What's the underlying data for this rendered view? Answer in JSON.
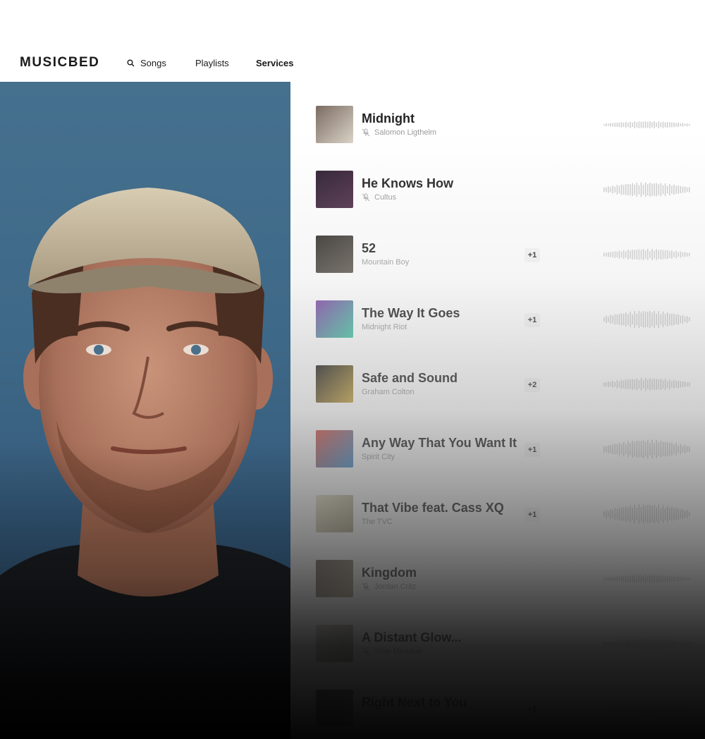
{
  "nav": {
    "logo": "MUSICBED",
    "songs": "Songs",
    "playlists": "Playlists",
    "services": "Services"
  },
  "songs": [
    {
      "title": "Midnight",
      "artist": "Salomon Ligthelm",
      "badge": "",
      "icon": true,
      "colors": [
        "#7a6a60",
        "#d9d2c6"
      ]
    },
    {
      "title": "He Knows How",
      "artist": "Cultus",
      "badge": "",
      "icon": true,
      "colors": [
        "#2a1a2e",
        "#4a2a44"
      ]
    },
    {
      "title": "52",
      "artist": "Mountain Boy",
      "badge": "+1",
      "icon": false,
      "colors": [
        "#2a2622",
        "#5a534b"
      ]
    },
    {
      "title": "The Way It Goes",
      "artist": "Midnight Riot",
      "badge": "+1",
      "icon": false,
      "colors": [
        "#7b3fa3",
        "#3cc7a2"
      ]
    },
    {
      "title": "Safe and Sound",
      "artist": "Graham Colton",
      "badge": "+2",
      "icon": false,
      "colors": [
        "#1a1a18",
        "#c7a13a"
      ]
    },
    {
      "title": "Any Way That You Want It",
      "artist": "Spirit City",
      "badge": "+1",
      "icon": false,
      "colors": [
        "#d24a3c",
        "#3a8fd0"
      ]
    },
    {
      "title": "That Vibe feat. Cass XQ",
      "artist": "The TVC",
      "badge": "+1",
      "icon": false,
      "colors": [
        "#e7e0c7",
        "#a79c7b"
      ]
    },
    {
      "title": "Kingdom",
      "artist": "Jordan Critz",
      "badge": "",
      "icon": true,
      "colors": [
        "#5a5046",
        "#a6977c"
      ]
    },
    {
      "title": "A Distant Glow...",
      "artist": "Slow Meadow",
      "badge": "",
      "icon": true,
      "colors": [
        "#cfcac3",
        "#8e8880"
      ]
    },
    {
      "title": "Right Next to You",
      "artist": "",
      "badge": "+1",
      "icon": false,
      "colors": [
        "#2a2a2a",
        "#5a5a5a"
      ]
    }
  ],
  "colors": {
    "accent": "#1f1f1f",
    "muted": "#999999"
  }
}
